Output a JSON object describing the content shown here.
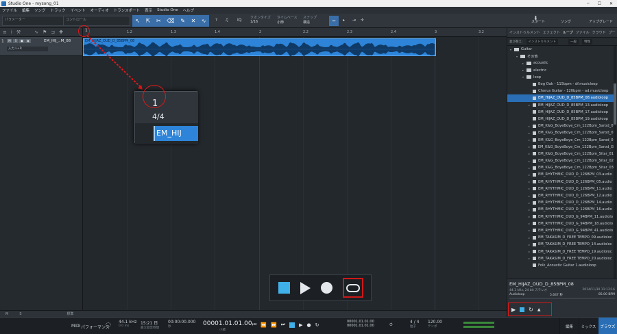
{
  "window": {
    "title": "Studio One - mysong_01"
  },
  "menu": [
    "ファイル",
    "編集",
    "ソング",
    "トラック",
    "イベント",
    "オーディオ",
    "トランスポート",
    "表示",
    "Studio One",
    "ヘルプ"
  ],
  "toolbar": {
    "param_label": "パラメーター",
    "control_label": "コントロール",
    "quantize_label": "クオンタイズ",
    "quantize_value": "1/16",
    "timebase_label": "タイムベース",
    "timebase_value": "小節",
    "snap_label": "スナップ",
    "snap_value": "構造",
    "iq": "IQ",
    "start": "スタート",
    "song": "ソング",
    "upgrade": "アップグレード"
  },
  "track": {
    "number": "1",
    "name": "EM_HIJ_..M_08",
    "buttons": [
      "M",
      "S",
      "●",
      "◉"
    ],
    "input": "入力 L+R"
  },
  "ruler": {
    "start_bar": "1",
    "ticks": [
      "1.2",
      "1.3",
      "1.4",
      "2",
      "2.2",
      "2.3",
      "2.4",
      "3",
      "3.2",
      "3.3",
      "3.4",
      "4"
    ]
  },
  "event": {
    "name": "EM_HIJAZ_OUD_D_85BPM_08"
  },
  "zoom": {
    "bar": "1",
    "signature": "4/4",
    "event": "EM_HIJ"
  },
  "browser": {
    "tabs": [
      "インストゥルメント",
      "エフェクト",
      "ループ",
      "ファイル",
      "クラウド",
      "プー"
    ],
    "active_tab": "ループ",
    "sort_label": "並び替え:",
    "sort_value": "インストゥルメント",
    "sort_extra1": "一般",
    "sort_extra2": "特性",
    "items": [
      {
        "label": "Guitar",
        "kind": "folder",
        "indent": 0,
        "caret": "▾"
      },
      {
        "label": "その他",
        "kind": "folder",
        "indent": 1,
        "caret": "▾"
      },
      {
        "label": "acoustic",
        "kind": "folder",
        "indent": 2,
        "caret": "▸"
      },
      {
        "label": "electric",
        "kind": "folder",
        "indent": 2,
        "caret": "▸"
      },
      {
        "label": "loop",
        "kind": "folder",
        "indent": 2,
        "caret": "▾"
      },
      {
        "label": "Bog Oak - 115bpm - df.musicloop",
        "kind": "file",
        "indent": 3,
        "caret": ""
      },
      {
        "label": "Chorus Guitar - 120bpm - ad.musicloop",
        "kind": "file",
        "indent": 3,
        "caret": ""
      },
      {
        "label": "EM_HIJAZ_OUD_D_85BPM_08.audioloop",
        "kind": "file",
        "indent": 3,
        "caret": "",
        "selected": true
      },
      {
        "label": "EM_HIJAZ_OUD_D_85BPM_13.audioloop",
        "kind": "file",
        "indent": 3,
        "caret": "▸"
      },
      {
        "label": "EM_HIJAZ_OUD_D_85BPM_17.audioloop",
        "kind": "file",
        "indent": 3,
        "caret": ""
      },
      {
        "label": "EM_HIJAZ_OUD_D_85BPM_19.audioloop",
        "kind": "file",
        "indent": 3,
        "caret": ""
      },
      {
        "label": "EM_K&G_BoyeBoye_Cm_122Bpm_Sarod_0",
        "kind": "file",
        "indent": 3,
        "caret": "▸"
      },
      {
        "label": "EM_K&G_BoyeBoye_Cm_122Bpm_Sarod_0",
        "kind": "file",
        "indent": 3,
        "caret": "▸"
      },
      {
        "label": "EM_K&G_BoyeBoye_Cm_122Bpm_Sarod_0",
        "kind": "file",
        "indent": 3,
        "caret": "▸"
      },
      {
        "label": "EM_K&G_BoyeBoye_Cm_122Bpm_Sarod_G",
        "kind": "file",
        "indent": 3,
        "caret": "▸"
      },
      {
        "label": "EM_K&G_BoyeBoye_Cm_122Bpm_Sitar_01",
        "kind": "file",
        "indent": 3,
        "caret": "▸"
      },
      {
        "label": "EM_K&G_BoyeBoye_Cm_122Bpm_Sitar_02",
        "kind": "file",
        "indent": 3,
        "caret": "▸"
      },
      {
        "label": "EM_K&G_BoyeBoye_Cm_122Bpm_Sitar_03",
        "kind": "file",
        "indent": 3,
        "caret": "▸"
      },
      {
        "label": "EM_RHYTHMIC_OUD_D_126BPM_03.audio",
        "kind": "file",
        "indent": 3,
        "caret": "▸"
      },
      {
        "label": "EM_RHYTHMIC_OUD_D_126BPM_05.audio",
        "kind": "file",
        "indent": 3,
        "caret": "▸"
      },
      {
        "label": "EM_RHYTHMIC_OUD_D_126BPM_11.audio",
        "kind": "file",
        "indent": 3,
        "caret": "▸"
      },
      {
        "label": "EM_RHYTHMIC_OUD_D_126BPM_12.audio",
        "kind": "file",
        "indent": 3,
        "caret": "▸"
      },
      {
        "label": "EM_RHYTHMIC_OUD_D_126BPM_14.audio",
        "kind": "file",
        "indent": 3,
        "caret": "▸"
      },
      {
        "label": "EM_RHYTHMIC_OUD_D_126BPM_16.audio",
        "kind": "file",
        "indent": 3,
        "caret": "▸"
      },
      {
        "label": "EM_RHYTHMIC_OUD_G_94BPM_11.audiolo",
        "kind": "file",
        "indent": 3,
        "caret": "▸"
      },
      {
        "label": "EM_RHYTHMIC_OUD_G_94BPM_18.audiolo",
        "kind": "file",
        "indent": 3,
        "caret": "▸"
      },
      {
        "label": "EM_RHYTHMIC_OUD_G_94BPM_41.audiolo",
        "kind": "file",
        "indent": 3,
        "caret": "▸"
      },
      {
        "label": "EM_TAKASIM_D_FREE TEMPO_09.audioloc",
        "kind": "file",
        "indent": 3,
        "caret": "▸"
      },
      {
        "label": "EM_TAKASIM_D_FREE TEMPO_14.audioloc",
        "kind": "file",
        "indent": 3,
        "caret": "▸"
      },
      {
        "label": "EM_TAKASIM_D_FREE TEMPO_19.audioloc",
        "kind": "file",
        "indent": 3,
        "caret": "▸"
      },
      {
        "label": "EM_TAKASIM_D_FREE TEMPO_20.audioloc",
        "kind": "file",
        "indent": 3,
        "caret": "▸"
      },
      {
        "label": "Folk_Acoustic Guitar 1.audioloop",
        "kind": "file",
        "indent": 3,
        "caret": ""
      }
    ]
  },
  "preview": {
    "title": "EM_HIJAZ_OUD_D_85BPM_08",
    "info": "44.1 kHz, 24 bit ステレオ",
    "date": "2014/11/30 11:13:16",
    "type": "Audioloop",
    "length": "5.647 秒",
    "tempo": "85.00 BPM"
  },
  "statusbar": {
    "m": "M",
    "s": "S",
    "zoom_label": "標準"
  },
  "transport": {
    "midi": "MIDI",
    "perf": "パフォーマンス",
    "rate": "44.1 kHz",
    "latency": "0.0 ms",
    "rec_time": "15:21 日",
    "rec_label": "最大録音時間",
    "time_secs": "00:00:00.000",
    "secs_label": "秒",
    "position": "00001.01.01.00",
    "pos_label": "小節",
    "loop_l": "00001.01.01.00",
    "loop_r": "00001.01.01.00",
    "signature": "4 / 4",
    "sig_label": "拍子",
    "tempo": "120.00",
    "tempo_label": "テンポ"
  },
  "pages": [
    "編集",
    "ミックス",
    "ブラウズ"
  ],
  "active_page": "ブラウズ"
}
